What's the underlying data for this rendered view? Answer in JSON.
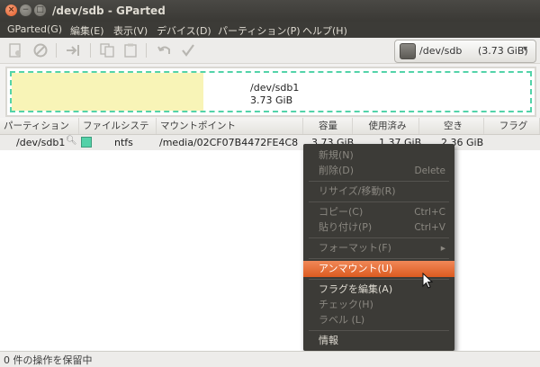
{
  "window": {
    "title": "/dev/sdb - GParted",
    "close_glyph": "×",
    "min_glyph": "−",
    "max_glyph": "□"
  },
  "menubar": {
    "items": [
      "GParted(G)",
      "編集(E)",
      "表示(V)",
      "デバイス(D)",
      "パーティション(P)",
      "ヘルプ(H)"
    ]
  },
  "toolbar": {
    "icons": [
      "new-icon",
      "delete-icon",
      "resize-move-icon",
      "copy-icon",
      "paste-icon",
      "undo-icon",
      "apply-icon"
    ]
  },
  "device_selector": {
    "name": "/dev/sdb",
    "size": "(3.73 GiB)"
  },
  "disk_graph": {
    "partition_name": "/dev/sdb1",
    "partition_size": "3.73 GiB",
    "used_fraction": 0.37,
    "used_color": "#f8f4b7",
    "border_color": "#53d3a9"
  },
  "table": {
    "headers": [
      "パーティション",
      "ファイルシステム",
      "マウントポイント",
      "容量",
      "使用済み",
      "空き",
      "フラグ"
    ],
    "rows": [
      {
        "partition": "/dev/sdb1",
        "filesystem": "ntfs",
        "fs_color": "#54d1a8",
        "mountpoint": "/media/02CF07B4472FE4C8",
        "size": "3.73 GiB",
        "used": "1.37 GiB",
        "unused": "2.36 GiB",
        "flags": ""
      }
    ]
  },
  "context_menu": {
    "new": "新規(N)",
    "delete": "削除(D)",
    "delete_accel": "Delete",
    "resize": "リサイズ/移動(R)",
    "copy": "コピー(C)",
    "copy_accel": "Ctrl+C",
    "paste": "貼り付け(P)",
    "paste_accel": "Ctrl+V",
    "format": "フォーマット(F)",
    "format_arrow": "▸",
    "unmount": "アンマウント(U)",
    "manage_flags": "フラグを編集(A)",
    "check": "チェック(H)",
    "label": "ラベル (L)",
    "info": "情報"
  },
  "statusbar": {
    "text": "0 件の操作を保留中"
  }
}
